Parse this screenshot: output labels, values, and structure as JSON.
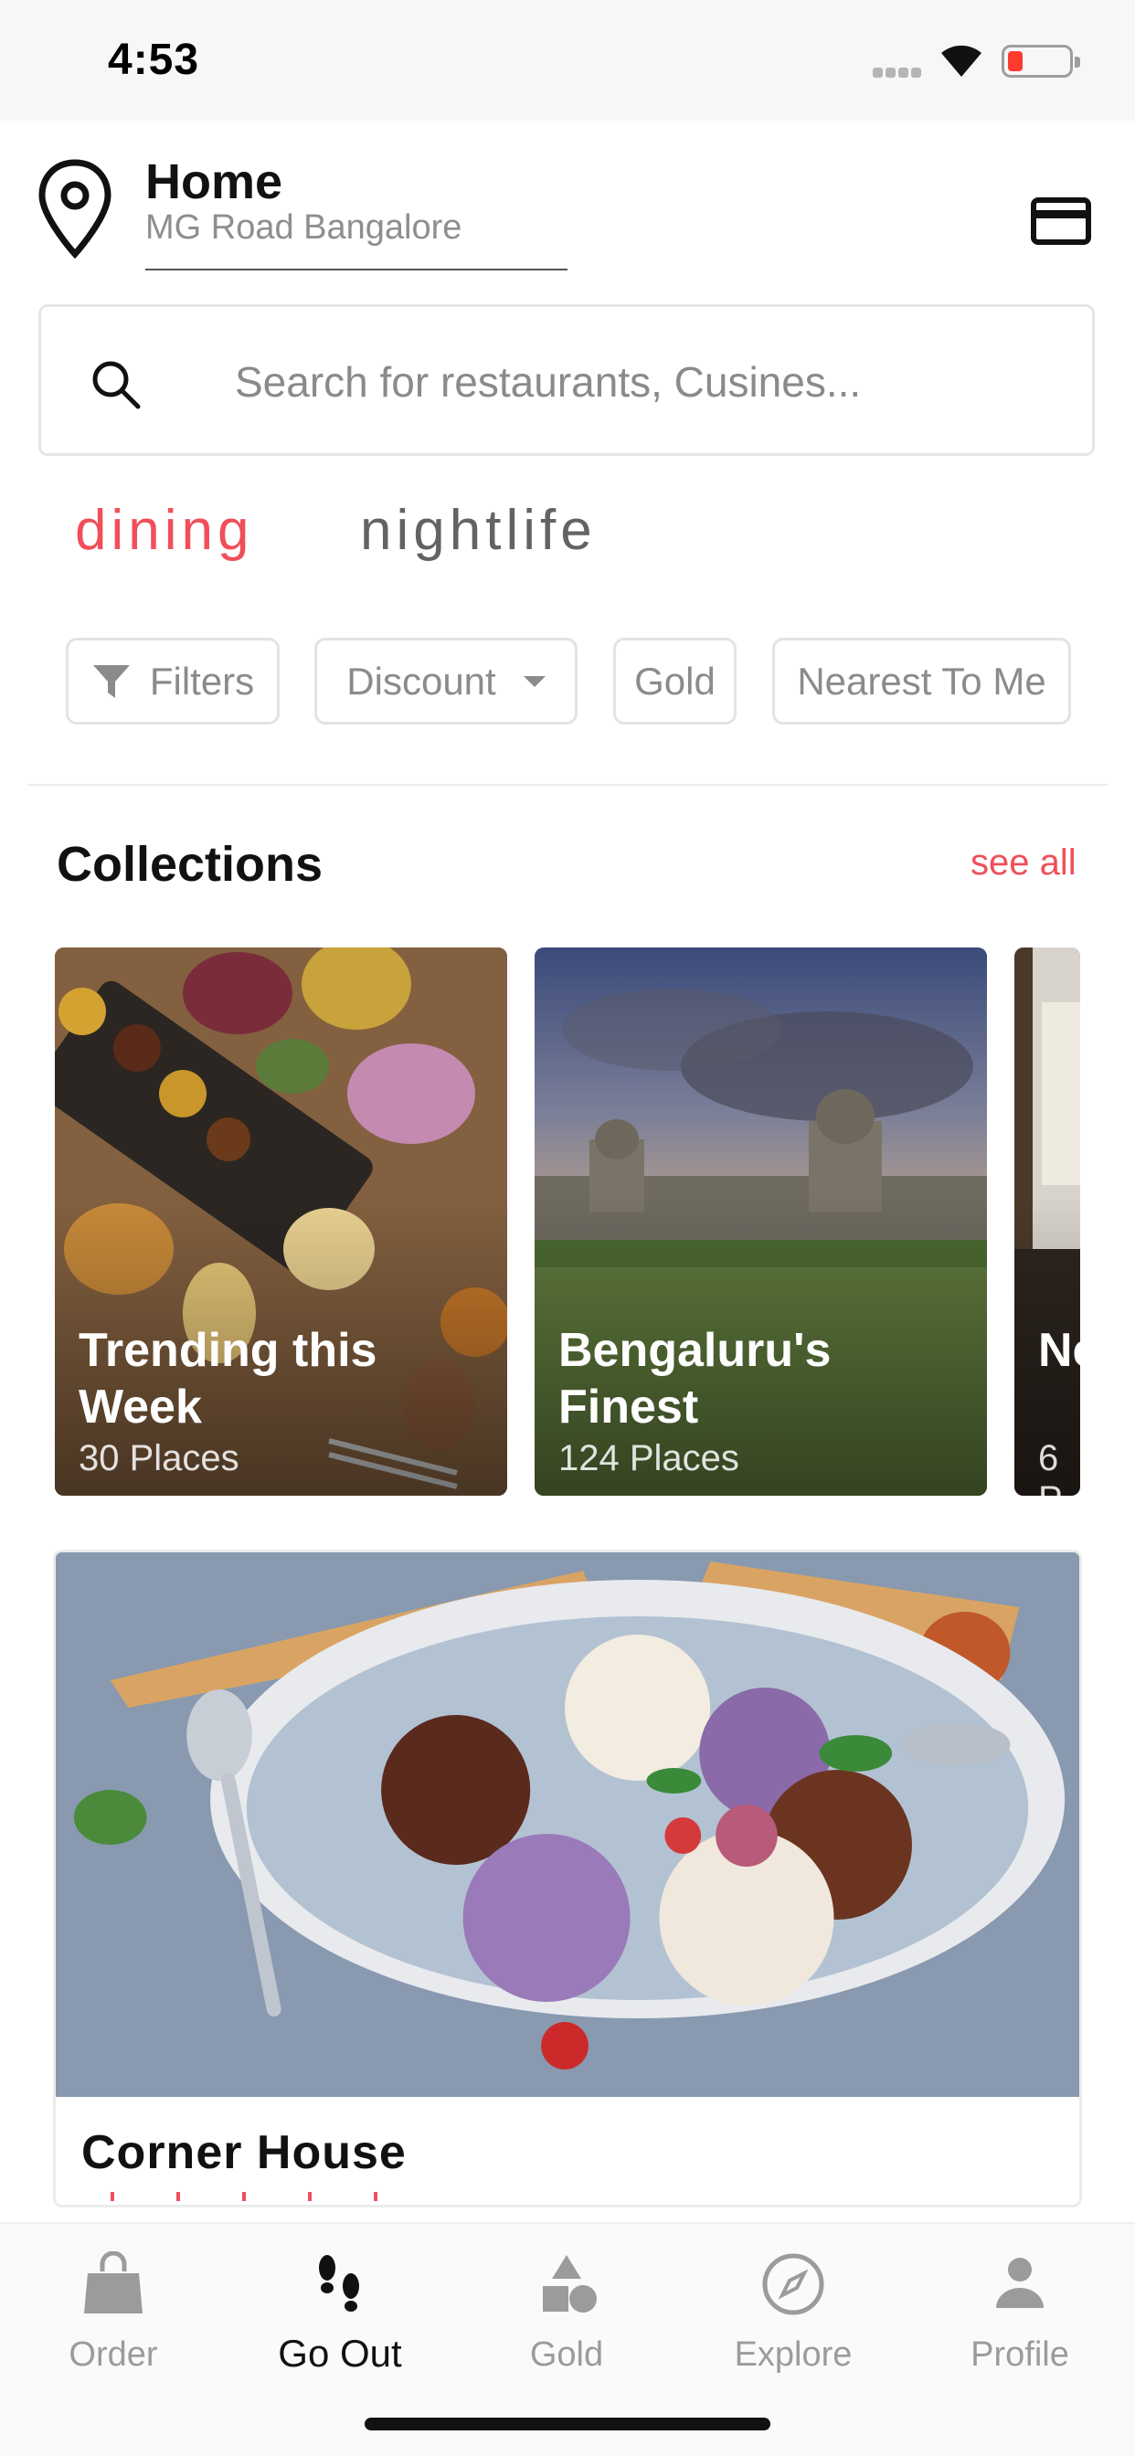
{
  "status_bar": {
    "time": "4:53"
  },
  "location": {
    "title": "Home",
    "subtitle": "MG Road Bangalore"
  },
  "search": {
    "placeholder": "Search for restaurants, Cusines..."
  },
  "mode_tabs": [
    {
      "label": "dining",
      "active": true
    },
    {
      "label": "nightlife",
      "active": false
    }
  ],
  "filters": [
    {
      "label": "Filters",
      "icon": "funnel-icon"
    },
    {
      "label": "Discount",
      "icon": "caret-down-icon"
    },
    {
      "label": "Gold"
    },
    {
      "label": "Nearest To Me"
    }
  ],
  "collections": {
    "title": "Collections",
    "see_all": "see all",
    "cards": [
      {
        "title": "Trending this Week",
        "count": "30 Places"
      },
      {
        "title": "Bengaluru's Finest",
        "count": "124 Places"
      },
      {
        "title": "Ne",
        "count": "6 P"
      }
    ]
  },
  "restaurant": {
    "name": "Corner House"
  },
  "bottom_nav": [
    {
      "label": "Order",
      "icon": "shopping-bag-icon",
      "active": false
    },
    {
      "label": "Go Out",
      "icon": "footprints-icon",
      "active": true
    },
    {
      "label": "Gold",
      "icon": "shapes-icon",
      "active": false
    },
    {
      "label": "Explore",
      "icon": "compass-icon",
      "active": false
    },
    {
      "label": "Profile",
      "icon": "person-icon",
      "active": false
    }
  ],
  "colors": {
    "accent": "#f04f5a",
    "inactive": "#9b9b9b",
    "text": "#111111"
  }
}
